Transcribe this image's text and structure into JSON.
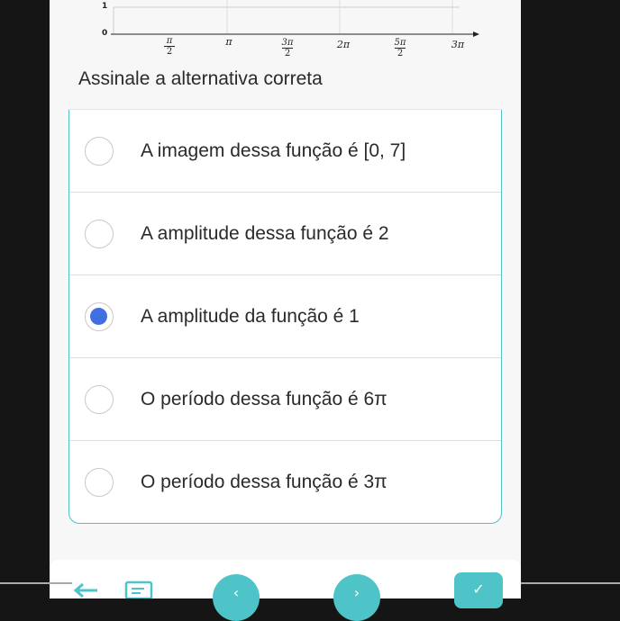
{
  "graph": {
    "y_labels": [
      "1",
      "0"
    ],
    "x_ticks": [
      {
        "num": "π",
        "den": "2"
      },
      {
        "num": "π",
        "den": ""
      },
      {
        "num": "3π",
        "den": "2"
      },
      {
        "num": "2π",
        "den": ""
      },
      {
        "num": "5π",
        "den": "2"
      },
      {
        "num": "3π",
        "den": ""
      }
    ]
  },
  "question": "Assinale a alternativa correta",
  "options": [
    {
      "label": "A imagem dessa função é [0, 7]",
      "selected": false
    },
    {
      "label": "A amplitude dessa função é 2",
      "selected": false
    },
    {
      "label": "A amplitude da função é 1",
      "selected": true
    },
    {
      "label": "O período dessa função é 6π",
      "selected": false
    },
    {
      "label": "O período dessa função é 3π",
      "selected": false
    }
  ],
  "nav": {
    "back_icon": "arrow-left-icon",
    "list_icon": "edit-list-icon",
    "prev_icon": "chevron-left-icon",
    "next_icon": "chevron-right-icon",
    "check_icon": "check-icon",
    "prev_glyph": "‹",
    "next_glyph": "›",
    "check_glyph": "✓"
  },
  "colors": {
    "accent": "#52c0c4",
    "selected": "#3f6fe0"
  }
}
